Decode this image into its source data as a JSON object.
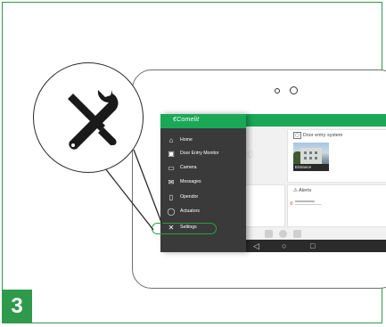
{
  "step": {
    "number": "3"
  },
  "colors": {
    "accent": "#2f9a4b",
    "screen_green": "#1aa857",
    "menu_bg": "#3a3a3a"
  },
  "magnifier": {
    "icon": "tools-icon"
  },
  "tablet": {
    "camera_dots": [
      "small-dot",
      "large-dot"
    ]
  },
  "sidebar": {
    "brand": "€Comelit",
    "items": [
      {
        "label": "Home",
        "icon": "home-icon",
        "glyph": "⌂"
      },
      {
        "label": "Door Entry Monitor",
        "icon": "monitor-icon",
        "glyph": "▣"
      },
      {
        "label": "Camera",
        "icon": "camera-icon",
        "glyph": "▭"
      },
      {
        "label": "Messages",
        "icon": "messages-icon",
        "glyph": "✉"
      },
      {
        "label": "Opendor",
        "icon": "opendoor-icon",
        "glyph": "▯"
      },
      {
        "label": "Actuators",
        "icon": "actuators-icon",
        "glyph": "◯"
      },
      {
        "label": "Settings",
        "icon": "settings-icon",
        "glyph": "✕"
      }
    ],
    "highlighted": "Settings"
  },
  "screen": {
    "door_panel": {
      "title": "Door entry system",
      "caption": "Entrance"
    },
    "alerts_panel": {
      "title": "Alerts"
    },
    "nav": {
      "back": "◁",
      "home": "○",
      "recent": "□"
    }
  }
}
